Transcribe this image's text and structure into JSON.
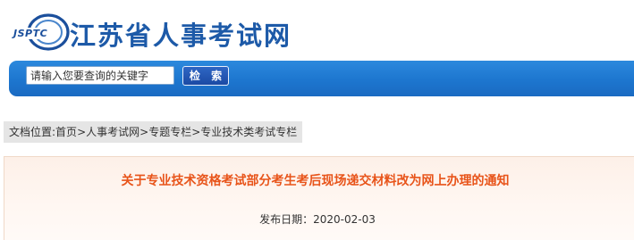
{
  "header": {
    "logo_abbr": "JSPTC",
    "site_title": "江苏省人事考试网"
  },
  "search": {
    "placeholder": "请输入您要查询的关键字",
    "button_label": "检 索"
  },
  "breadcrumb": {
    "prefix": "文档位置:",
    "items": [
      "首页",
      "人事考试网",
      "专题专栏",
      "专业技术类考试专栏"
    ],
    "separator": ">"
  },
  "article": {
    "title": "关于专业技术资格考试部分考生考后现场递交材料改为网上办理的通知",
    "date_label": "发布日期：",
    "date_value": "2020-02-03"
  },
  "colors": {
    "brand_blue": "#1d5aa8",
    "search_bar_blue": "#1d76cf",
    "title_orange": "#e8541a"
  }
}
